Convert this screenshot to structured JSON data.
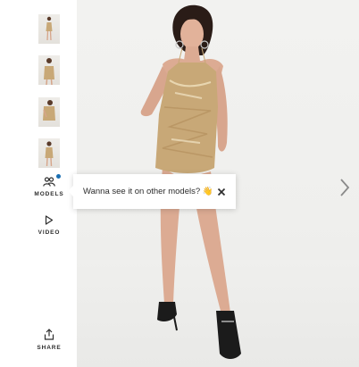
{
  "gallery": {
    "thumbnails": [
      {
        "name": "thumbnail-front"
      },
      {
        "name": "thumbnail-close-up"
      },
      {
        "name": "thumbnail-side"
      },
      {
        "name": "thumbnail-back"
      }
    ],
    "models_label": "MODELS",
    "video_label": "VIDEO",
    "share_label": "SHARE",
    "models_indicator_color": "#1b6fb2"
  },
  "tooltip": {
    "message": "Wanna see it on other models? 👋"
  },
  "icons": {
    "models": "people-icon",
    "video": "play-icon",
    "share": "share-icon",
    "next": "chevron-right-icon",
    "close": "close-icon"
  },
  "colors": {
    "dress": "#c8a877",
    "background": "#f0f0ee",
    "text": "#2d2d2d"
  }
}
